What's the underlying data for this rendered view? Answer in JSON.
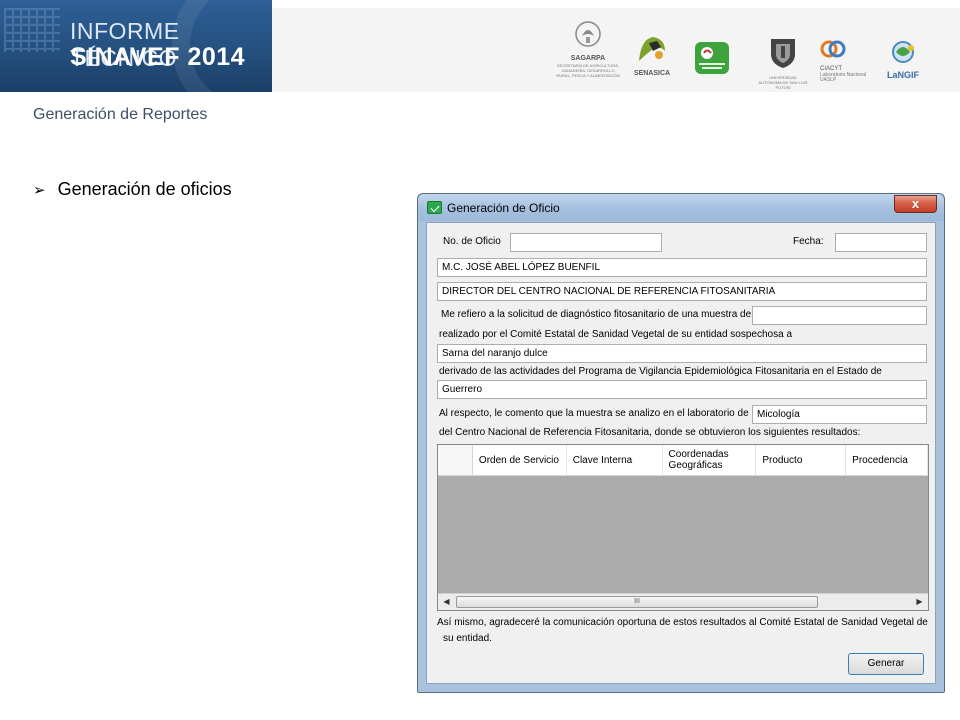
{
  "slide": {
    "banner_line1": "INFORME TÉCNICO",
    "banner_line2": "SINAVEF 2014",
    "section_title": "Generación de Reportes",
    "bullet_text": "Generación de oficios"
  },
  "logos": [
    {
      "name": "SAGARPA",
      "caption": "SAGARPA",
      "sub": "SECRETARÍA DE AGRICULTURA, GANADERÍA, DESARROLLO RURAL, PESCA Y ALIMENTACIÓN"
    },
    {
      "name": "SENASICA",
      "caption": "SENASICA",
      "sub": ""
    },
    {
      "name": "SINAVEF",
      "caption": "SINAVEF",
      "sub": ""
    },
    {
      "name": "UASLP",
      "caption": "",
      "sub": "UNIVERSIDAD AUTÓNOMA DE SAN LUIS POTOSÍ"
    },
    {
      "name": "CIACYT",
      "caption": "CIACYT",
      "sub": "Laboratorio Nacional UASLP"
    },
    {
      "name": "LaNGIF",
      "caption": "LaNGIF",
      "sub": ""
    }
  ],
  "dialog": {
    "title": "Generación de Oficio",
    "close_label": "x",
    "no_oficio_label": "No. de Oficio",
    "no_oficio_value": "",
    "fecha_label": "Fecha:",
    "fecha_value": "",
    "nombre_value": "M.C. JOSÉ ABEL LÓPEZ BUENFIL",
    "cargo_value": "DIRECTOR DEL CENTRO NACIONAL DE REFERENCIA FITOSANITARIA",
    "text_solicitud": "Me refiero a la solicitud de diagnóstico fitosanitario de una muestra de",
    "muestra_value": "",
    "text_comite": "realizado por el Comité Estatal de Sanidad Vegetal de su entidad sospechosa a",
    "sospecha_value": "Sarna del naranjo dulce",
    "text_derivado": "derivado de las actividades del Programa de Vigilancia Epidemiológica Fitosanitaria en el Estado de",
    "estado_value": "Guerrero",
    "text_respecto": "Al respecto, le comento que la muestra se analizo en el laboratorio de",
    "laboratorio_value": "Micología",
    "text_centro": "del Centro Nacional de Referencia Fitosanitaria, donde se obtuvieron los siguientes resultados:",
    "grid_columns": [
      "Orden de Servicio",
      "Clave Interna",
      "Coordenadas Geográficas",
      "Producto",
      "Procedencia"
    ],
    "scroll_left": "◀",
    "scroll_right": "▶",
    "scroll_grip": "III",
    "text_agradecimiento_1": "Así mismo, agradeceré la comunicación oportuna de estos resultados al Comité Estatal de Sanidad Vegetal de",
    "text_agradecimiento_2": "su entidad.",
    "generar_label": "Generar"
  }
}
